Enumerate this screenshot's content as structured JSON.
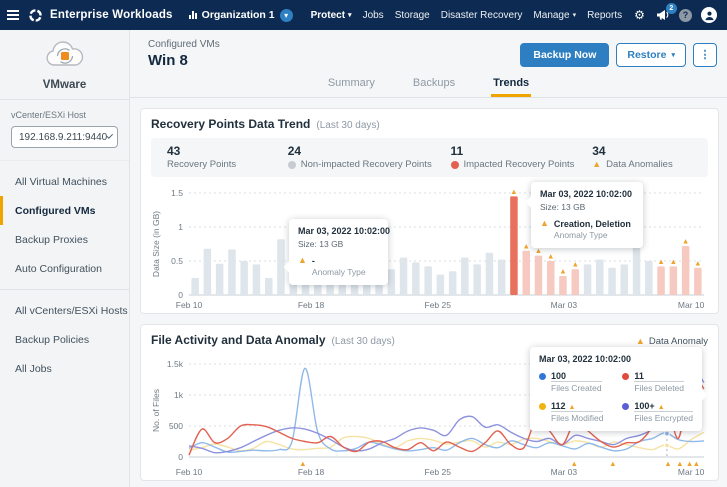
{
  "navbar": {
    "brand": "Enterprise Workloads",
    "org_label": "Organization 1",
    "items": [
      {
        "label": "Protect",
        "caret": true
      },
      {
        "label": "Jobs",
        "caret": false
      },
      {
        "label": "Storage",
        "caret": false
      },
      {
        "label": "Disaster Recovery",
        "caret": false
      },
      {
        "label": "Manage",
        "caret": true
      },
      {
        "label": "Reports",
        "caret": false
      }
    ],
    "notification_count": "2",
    "help_glyph": "?"
  },
  "sidebar": {
    "platform": "VMware",
    "host_label": "vCenter/ESXi Host",
    "host_value": "192.168.9.211:9440",
    "items": [
      {
        "label": "All Virtual Machines"
      },
      {
        "label": "Configured VMs"
      },
      {
        "label": "Backup Proxies"
      },
      {
        "label": "Auto Configuration"
      },
      {
        "label": "All vCenters/ESXi Hosts"
      },
      {
        "label": "Backup Policies"
      },
      {
        "label": "All Jobs"
      }
    ],
    "active_item": "Configured VMs"
  },
  "header": {
    "breadcrumb": "Configured VMs",
    "title": "Win 8",
    "backup_label": "Backup Now",
    "restore_label": "Restore",
    "kebab_glyph": "⋮"
  },
  "tabs": {
    "items": [
      "Summary",
      "Backups",
      "Trends"
    ],
    "active": "Trends"
  },
  "recovery_card": {
    "title": "Recovery Points Data Trend",
    "subtitle": "(Last 30 days)",
    "stats": [
      {
        "value": "43",
        "label": "Recovery Points"
      },
      {
        "value": "24",
        "label": "Non-impacted Recovery Points"
      },
      {
        "value": "11",
        "label": "Impacted Recovery Points"
      },
      {
        "value": "34",
        "label": "Data Anomalies"
      }
    ],
    "tooltips": [
      {
        "title": "Mar 03, 2022 10:02:00",
        "size": "Size: 13 GB",
        "anomaly_value": "-",
        "anomaly_label": "Anomaly Type"
      },
      {
        "title": "Mar 03, 2022 10:02:00",
        "size": "Size: 13 GB",
        "anomaly_value": "Creation, Deletion",
        "anomaly_label": "Anomaly Type"
      }
    ]
  },
  "file_card": {
    "title": "File Activity and Data Anomaly",
    "subtitle": "(Last 30 days)",
    "legend_label": "Data Anomaly",
    "tooltip": {
      "title": "Mar 03, 2022 10:02:00",
      "items": [
        {
          "value": "100",
          "label": "Files Created",
          "color": "#3178d6",
          "warn": false
        },
        {
          "value": "11",
          "label": "Files Deleted",
          "color": "#e14b3b",
          "warn": false
        },
        {
          "value": "112",
          "label": "Files Modified",
          "color": "#f0b310",
          "warn": true
        },
        {
          "value": "100+",
          "label": "Files Encrypted",
          "color": "#5b5fd6",
          "warn": true
        }
      ]
    }
  },
  "chart_data": [
    {
      "type": "bar",
      "title": "Recovery Points Data Trend",
      "ylabel": "Data Size (in GB)",
      "ylim": [
        0,
        1.5
      ],
      "yticks": [
        "0",
        "0.5",
        "1",
        "1.5"
      ],
      "ytick_values": [
        0,
        0.5,
        1,
        1.5
      ],
      "xticks": [
        "Feb 10",
        "Feb 18",
        "Feb 25",
        "Mar 03",
        "Mar 10"
      ],
      "xtick_fracs": [
        0.0,
        0.237,
        0.483,
        0.728,
        0.975
      ],
      "grid": "dotted-horizontal",
      "colors": {
        "normal": "#dee5eb",
        "impacted": "#e8705c",
        "anomaly": "#f7cac1",
        "triangle": "#efa32b"
      },
      "bars": [
        {
          "v": 0.25,
          "t": "normal"
        },
        {
          "v": 0.68,
          "t": "normal"
        },
        {
          "v": 0.46,
          "t": "normal"
        },
        {
          "v": 0.67,
          "t": "normal"
        },
        {
          "v": 0.5,
          "t": "normal"
        },
        {
          "v": 0.45,
          "t": "normal"
        },
        {
          "v": 0.25,
          "t": "normal"
        },
        {
          "v": 0.82,
          "t": "normal"
        },
        {
          "v": 0.78,
          "t": "normal"
        },
        {
          "v": 0.3,
          "t": "normal"
        },
        {
          "v": 0.27,
          "t": "normal"
        },
        {
          "v": 0.24,
          "t": "normal"
        },
        {
          "v": 0.26,
          "t": "normal"
        },
        {
          "v": 0.3,
          "t": "normal"
        },
        {
          "v": 0.4,
          "t": "normal"
        },
        {
          "v": 0.35,
          "t": "normal"
        },
        {
          "v": 0.38,
          "t": "normal"
        },
        {
          "v": 0.55,
          "t": "normal"
        },
        {
          "v": 0.48,
          "t": "normal"
        },
        {
          "v": 0.42,
          "t": "normal"
        },
        {
          "v": 0.3,
          "t": "normal"
        },
        {
          "v": 0.35,
          "t": "normal"
        },
        {
          "v": 0.55,
          "t": "normal"
        },
        {
          "v": 0.45,
          "t": "normal"
        },
        {
          "v": 0.62,
          "t": "normal"
        },
        {
          "v": 0.52,
          "t": "normal"
        },
        {
          "v": 1.45,
          "t": "impacted"
        },
        {
          "v": 0.65,
          "t": "anomaly"
        },
        {
          "v": 0.58,
          "t": "anomaly"
        },
        {
          "v": 0.5,
          "t": "anomaly"
        },
        {
          "v": 0.28,
          "t": "anomaly"
        },
        {
          "v": 0.38,
          "t": "anomaly"
        },
        {
          "v": 0.45,
          "t": "normal"
        },
        {
          "v": 0.52,
          "t": "normal"
        },
        {
          "v": 0.4,
          "t": "normal"
        },
        {
          "v": 0.45,
          "t": "normal"
        },
        {
          "v": 0.95,
          "t": "normal"
        },
        {
          "v": 0.5,
          "t": "normal"
        },
        {
          "v": 0.42,
          "t": "anomaly"
        },
        {
          "v": 0.42,
          "t": "anomaly"
        },
        {
          "v": 0.72,
          "t": "anomaly"
        },
        {
          "v": 0.4,
          "t": "anomaly"
        }
      ]
    },
    {
      "type": "line",
      "title": "File Activity and Data Anomaly",
      "ylabel": "No. of Files",
      "ylim": [
        0,
        1500
      ],
      "yticks": [
        "0",
        "500",
        "1k",
        "1.5k"
      ],
      "ytick_values": [
        0,
        500,
        1000,
        1500
      ],
      "xticks": [
        "Feb 10",
        "Feb 18",
        "Feb 25",
        "Mar 03",
        "Mar 10"
      ],
      "xtick_fracs": [
        0.0,
        0.237,
        0.483,
        0.728,
        0.975
      ],
      "grid": "dotted-horizontal",
      "hover_x": 0.928,
      "anomaly_marks_x": [
        0.221,
        0.748,
        0.823,
        0.93,
        0.953,
        0.972,
        0.985
      ],
      "series": [
        {
          "name": "Files Modified",
          "color": "#f6e2a4",
          "values": [
            110,
            150,
            210,
            160,
            100,
            140,
            250,
            200,
            130,
            120,
            140,
            160,
            310,
            330,
            300,
            210,
            150,
            260,
            300,
            270,
            210,
            240,
            260,
            160,
            240,
            200,
            290,
            300,
            250,
            200,
            260,
            230,
            160,
            240,
            200,
            150,
            120,
            195,
            130,
            280,
            400
          ]
        },
        {
          "name": "Files Created",
          "color": "#8fb9e9",
          "values": [
            140,
            230,
            160,
            80,
            90,
            110,
            100,
            120,
            250,
            1430,
            400,
            130,
            100,
            140,
            240,
            190,
            130,
            100,
            120,
            150,
            110,
            230,
            300,
            200,
            150,
            260,
            200,
            150,
            230,
            180,
            130,
            220,
            160,
            100,
            130,
            250,
            300,
            390,
            280,
            250,
            260
          ]
        },
        {
          "name": "Files Encrypted",
          "color": "#8e93de",
          "values": [
            180,
            140,
            70,
            90,
            150,
            250,
            350,
            430,
            470,
            450,
            380,
            280,
            160,
            100,
            130,
            230,
            300,
            420,
            470,
            430,
            350,
            600,
            650,
            480,
            520,
            400,
            300,
            250,
            300,
            200,
            350,
            300,
            250,
            200,
            300,
            350,
            450,
            680,
            900,
            1430,
            1200
          ]
        },
        {
          "name": "Files Deleted",
          "color": "#e2614f",
          "values": [
            30,
            450,
            230,
            300,
            500,
            520,
            490,
            400,
            300,
            250,
            230,
            330,
            160,
            90,
            240,
            250,
            150,
            120,
            230,
            100,
            240,
            160,
            90,
            230,
            420,
            200,
            150,
            600,
            420,
            200,
            580,
            420,
            250,
            160,
            230,
            250,
            500,
            980,
            300,
            1280,
            1100
          ]
        }
      ]
    }
  ]
}
